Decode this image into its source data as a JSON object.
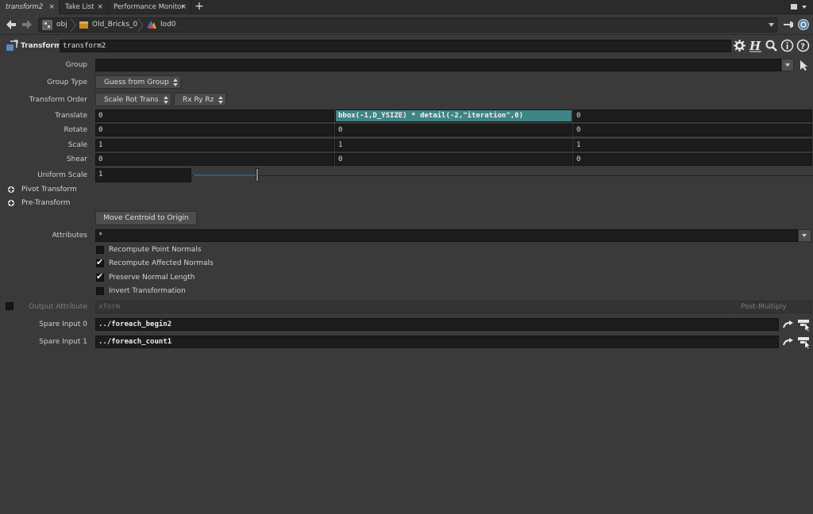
{
  "tabs": [
    {
      "label": "transform2",
      "active": true
    },
    {
      "label": "Take List",
      "active": false
    },
    {
      "label": "Performance Monitor",
      "active": false
    }
  ],
  "path": {
    "items": [
      {
        "label": "obj",
        "icon": "obj-network-icon"
      },
      {
        "label": "Old_Bricks_0",
        "icon": "geometry-node-icon"
      },
      {
        "label": "lod0",
        "icon": "subnet-icon"
      }
    ]
  },
  "operator": {
    "type": "Transform",
    "name": "transform2"
  },
  "parms": {
    "group": {
      "label": "Group",
      "value": ""
    },
    "group_type": {
      "label": "Group Type",
      "value": "Guess from Group"
    },
    "transform_order": {
      "label": "Transform Order",
      "value": "Scale Rot Trans",
      "rot_value": "Rx Ry Rz"
    },
    "translate": {
      "label": "Translate",
      "x": "0",
      "y": "bbox(-1,D_YSIZE) * detail(-2,\"iteration\",0)",
      "z": "0"
    },
    "rotate": {
      "label": "Rotate",
      "x": "0",
      "y": "0",
      "z": "0"
    },
    "scale": {
      "label": "Scale",
      "x": "1",
      "y": "1",
      "z": "1"
    },
    "shear": {
      "label": "Shear",
      "x": "0",
      "y": "0",
      "z": "0"
    },
    "uniform_scale": {
      "label": "Uniform Scale",
      "value": "1",
      "slider_fraction": 0.1
    },
    "pivot_transform": {
      "label": "Pivot Transform"
    },
    "pre_transform": {
      "label": "Pre-Transform"
    },
    "move_centroid": {
      "label": "Move Centroid to Origin"
    },
    "attributes": {
      "label": "Attributes",
      "value": "*"
    },
    "recompute_point_normals": {
      "label": "Recompute Point Normals",
      "checked": false
    },
    "recompute_affected_normals": {
      "label": "Recompute Affected Normals",
      "checked": true
    },
    "preserve_normal_length": {
      "label": "Preserve Normal Length",
      "checked": true
    },
    "invert_transformation": {
      "label": "Invert Transformation",
      "checked": false
    },
    "output_attribute": {
      "label": "Output Attribute",
      "value": "xform",
      "mode": "Post-Multiply",
      "enabled": false
    },
    "spare_input_0": {
      "label": "Spare Input 0",
      "value": "../foreach_begin2"
    },
    "spare_input_1": {
      "label": "Spare Input 1",
      "value": "../foreach_count1"
    }
  },
  "colors": {
    "background": "#3a3a3a",
    "field": "#1c1c1c",
    "expression": "#3f8585",
    "slider": "#2b5d8d"
  }
}
